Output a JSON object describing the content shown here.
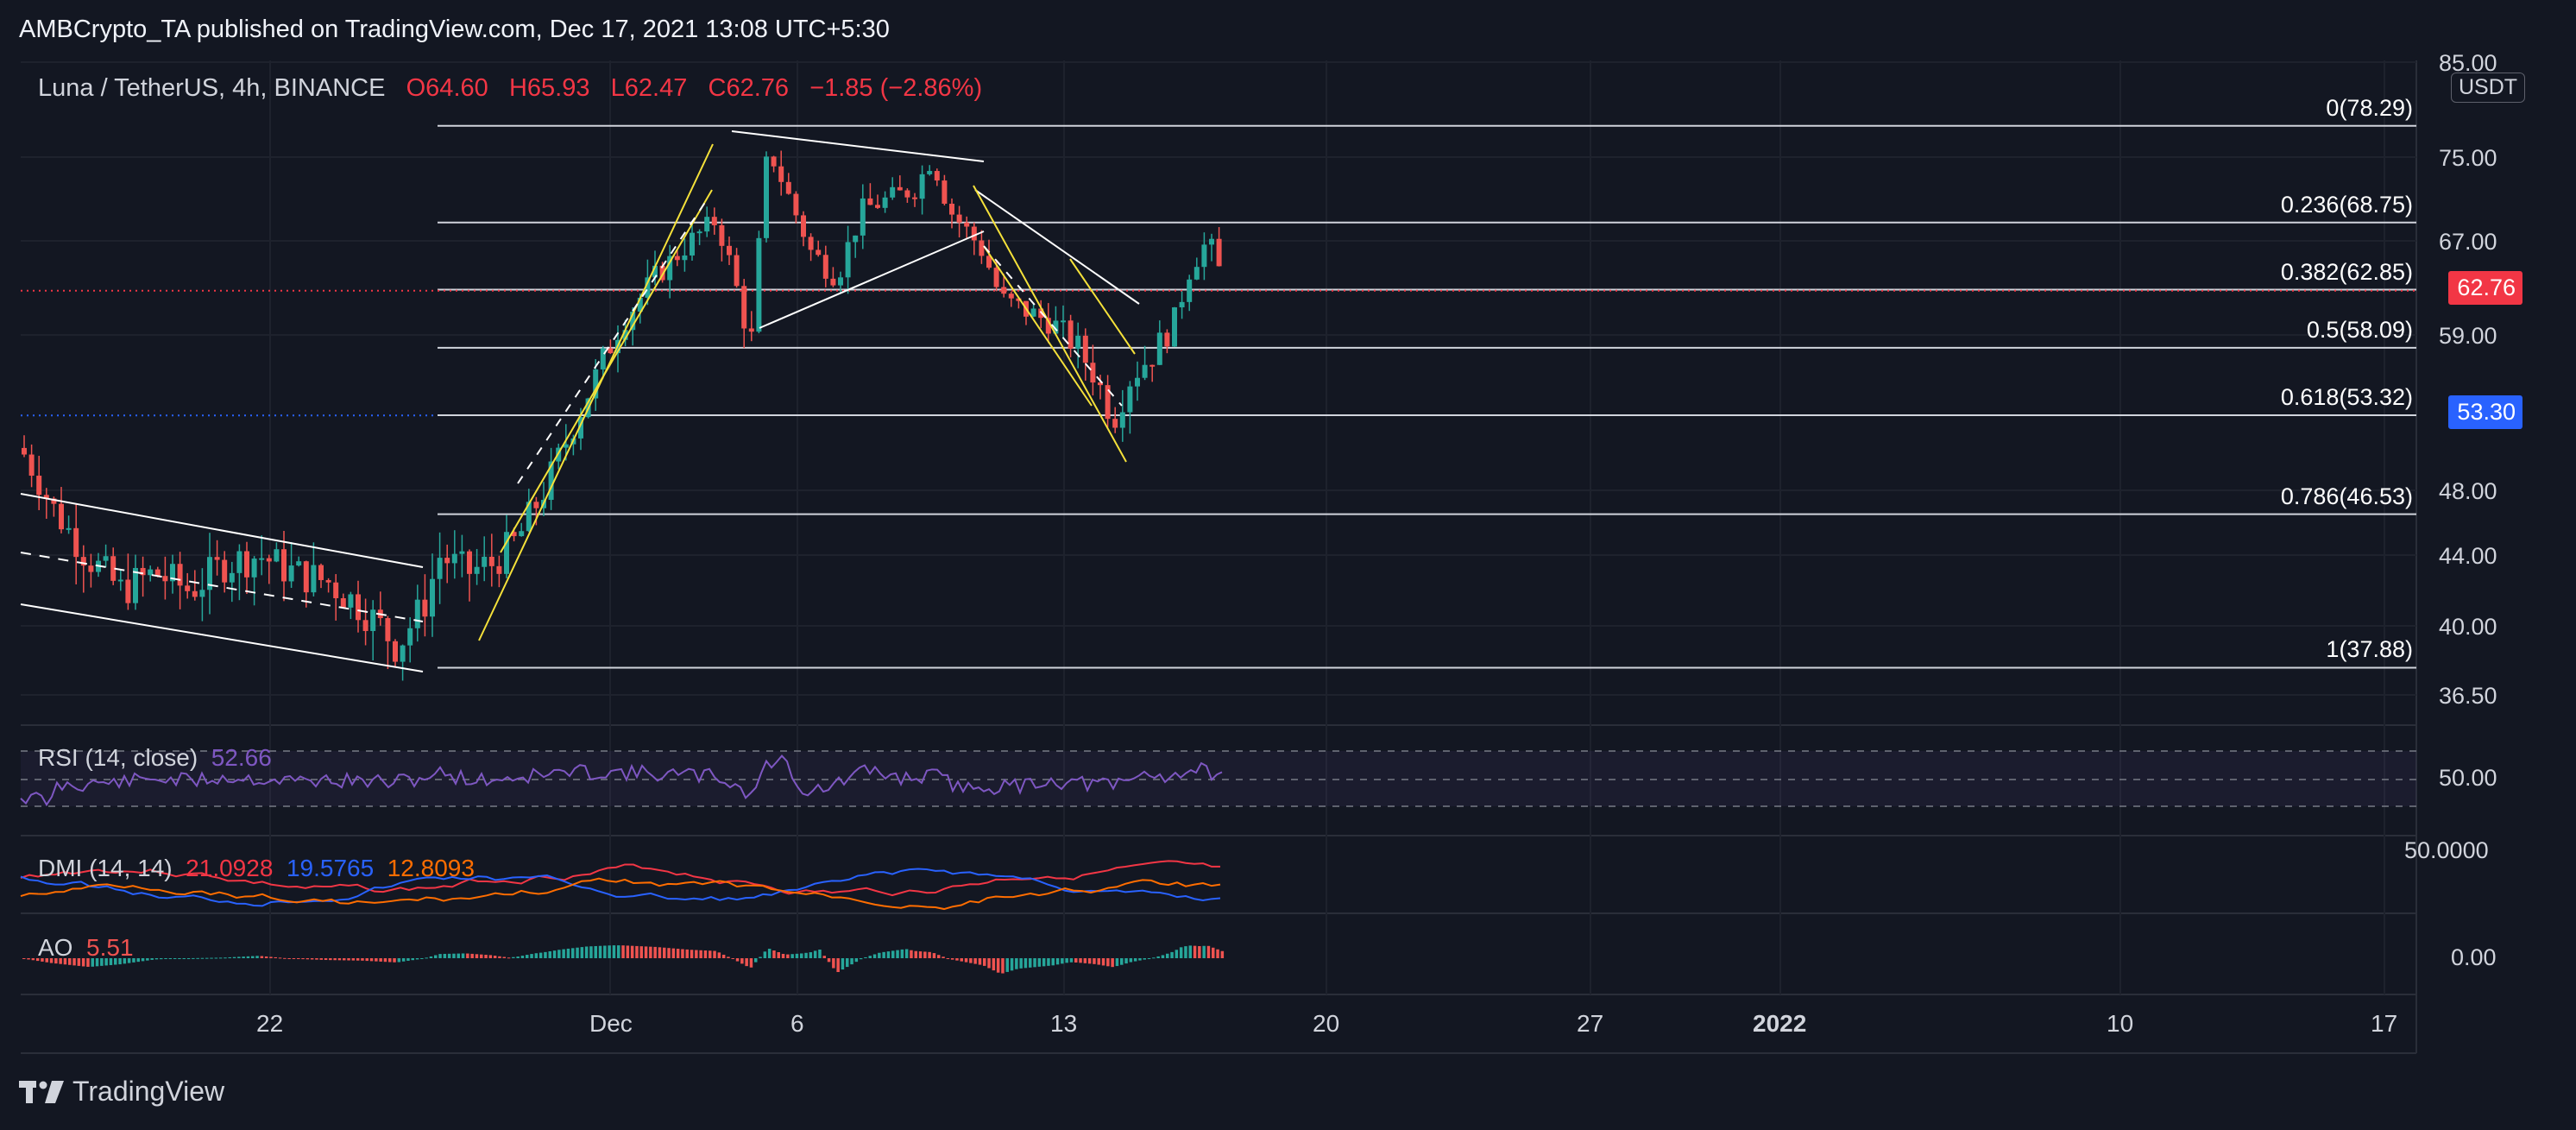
{
  "header": {
    "text": "AMBCrypto_TA published on TradingView.com, Dec 17, 2021 13:08 UTC+5:30"
  },
  "symbol": {
    "label": "Luna / TetherUS, 4h, BINANCE",
    "open": "O64.60",
    "high": "H65.93",
    "low": "L62.47",
    "close": "C62.76",
    "change": "−1.85 (−2.86%)"
  },
  "currency": "USDT",
  "price_axis": [
    "85.00",
    "75.00",
    "67.00",
    "59.00",
    "48.00",
    "44.00",
    "40.00",
    "36.50"
  ],
  "last_price": "62.76",
  "level_badge": "53.30",
  "fib_levels": [
    {
      "label": "0(78.29)",
      "value": 78.29
    },
    {
      "label": "0.236(68.75)",
      "value": 68.75
    },
    {
      "label": "0.382(62.85)",
      "value": 62.85
    },
    {
      "label": "0.5(58.09)",
      "value": 58.09
    },
    {
      "label": "0.618(53.32)",
      "value": 53.32
    },
    {
      "label": "0.786(46.53)",
      "value": 46.53
    },
    {
      "label": "1(37.88)",
      "value": 37.88
    }
  ],
  "rsi": {
    "label": "RSI (14, close)",
    "value": "52.66",
    "axis": "50.00"
  },
  "dmi": {
    "label": "DMI (14, 14)",
    "v1": "21.0928",
    "v2": "19.5765",
    "v3": "12.8093",
    "axis": "50.0000"
  },
  "ao": {
    "label": "AO",
    "value": "5.51",
    "axis": "0.00"
  },
  "time_axis": [
    "22",
    "Dec",
    "6",
    "13",
    "20",
    "27",
    "2022",
    "10",
    "17"
  ],
  "footer": {
    "brand": "TradingView"
  },
  "colors": {
    "up": "#26a69a",
    "down": "#ef5350",
    "bg": "#131722",
    "last": "#f23645",
    "level": "#2962ff"
  }
}
